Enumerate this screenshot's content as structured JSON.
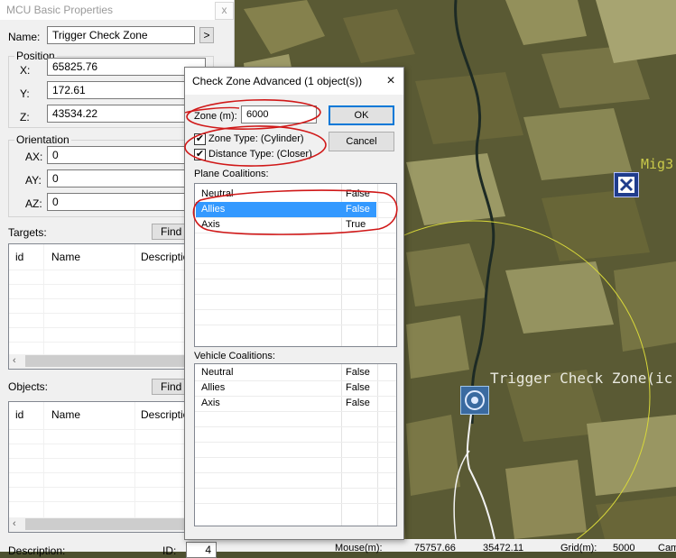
{
  "mcu_panel": {
    "title": "MCU Basic Properties",
    "close_glyph": "x",
    "name_label": "Name:",
    "name_value": "Trigger Check Zone",
    "name_button": ">",
    "position": {
      "label": "Position",
      "x_label": "X:",
      "x_value": "65825.76",
      "y_label": "Y:",
      "y_value": "172.61",
      "z_label": "Z:",
      "z_value": "43534.22"
    },
    "orientation": {
      "label": "Orientation",
      "ax_label": "AX:",
      "ax_value": "0",
      "ay_label": "AY:",
      "ay_value": "0",
      "az_label": "AZ:",
      "az_value": "0"
    },
    "targets": {
      "label": "Targets:",
      "find_button": "Find t",
      "columns": [
        "id",
        "Name",
        "Description"
      ]
    },
    "objects": {
      "label": "Objects:",
      "find_button": "Find o",
      "columns": [
        "id",
        "Name",
        "Description"
      ]
    },
    "description_label": "Description:",
    "id_label": "ID:",
    "id_value": "4"
  },
  "dialog": {
    "title": "Check Zone Advanced (1 object(s))",
    "close_glyph": "×",
    "zone_label": "Zone (m):",
    "zone_value": "6000",
    "ok_button": "OK",
    "cancel_button": "Cancel",
    "zone_type_label": "Zone Type: (Cylinder)",
    "zone_type_checked": true,
    "distance_type_label": "Distance Type: (Closer)",
    "distance_type_checked": true,
    "plane_coalitions_label": "Plane Coalitions:",
    "plane_coalitions": [
      {
        "name": "Neutral",
        "value": "False"
      },
      {
        "name": "Allies",
        "value": "False",
        "selected": true
      },
      {
        "name": "Axis",
        "value": "True"
      }
    ],
    "vehicle_coalitions_label": "Vehicle Coalitions:",
    "vehicle_coalitions": [
      {
        "name": "Neutral",
        "value": "False"
      },
      {
        "name": "Allies",
        "value": "False"
      },
      {
        "name": "Axis",
        "value": "False"
      }
    ]
  },
  "map": {
    "trigger_label": "Trigger Check Zone(ic",
    "aircraft_label": "Mig3",
    "zone_circle_color": "#d8d83a",
    "icons": [
      "aircraft-icon",
      "check-zone-icon"
    ]
  },
  "status_bar": {
    "mouse_label": "Mouse(m):",
    "mouse_x": "75757.66",
    "mouse_z": "35472.11",
    "grid_label": "Grid(m):",
    "grid_value": "5000",
    "camera_label": "Cam"
  },
  "colors": {
    "selection": "#3399ff",
    "annotation": "#d01818",
    "ok_border": "#0078d7"
  }
}
